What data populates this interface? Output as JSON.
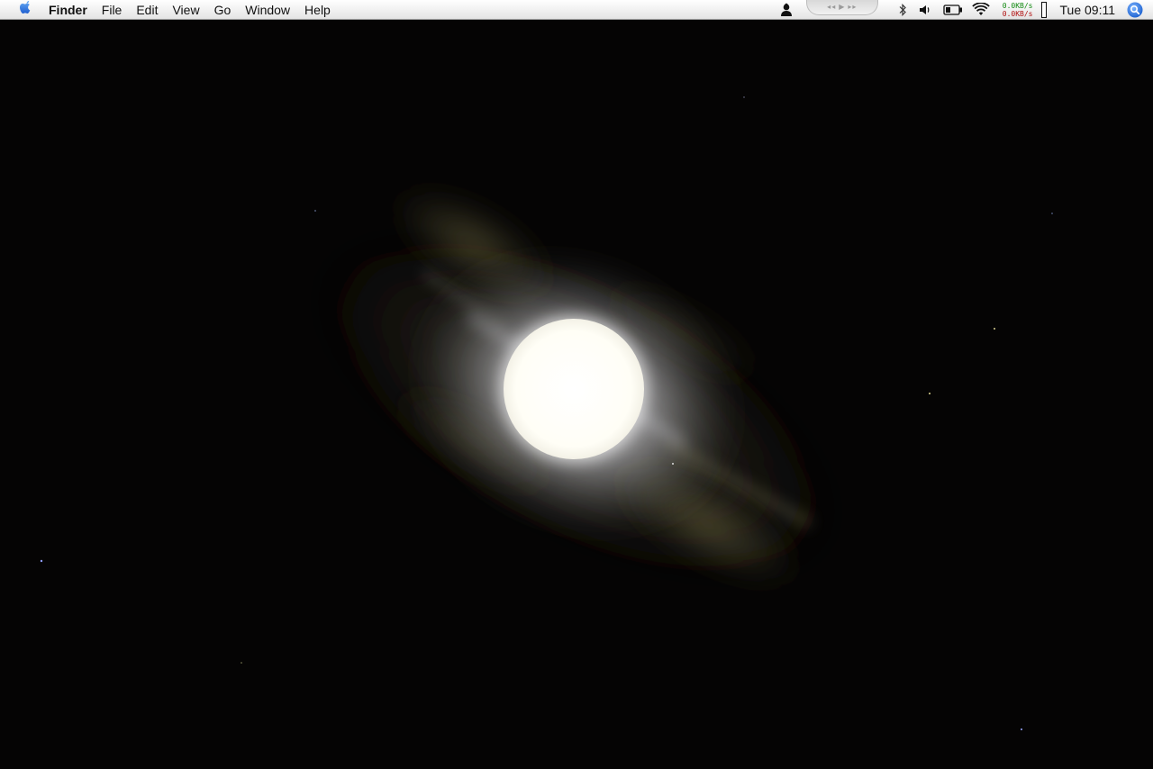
{
  "menubar": {
    "apple_icon": "apple-icon",
    "app_name": "Finder",
    "menus": [
      "File",
      "Edit",
      "View",
      "Go",
      "Window",
      "Help"
    ],
    "status_icons": [
      "user-silhouette-icon",
      "media-controls",
      "bluetooth-icon",
      "volume-icon",
      "battery-icon",
      "wifi-icon"
    ],
    "network": {
      "upload": "0.0KB/s",
      "download": "0.0KB/s"
    },
    "clock": "Tue 09:11",
    "spotlight_icon": "spotlight-search-icon"
  },
  "desktop": {
    "wallpaper": "night sky with full moon and halo"
  },
  "colors": {
    "menubar_bg": "#f0f0f0",
    "desktop_bg": "#050404",
    "moon": "#ffffff",
    "halo": "#6b6a4e",
    "spotlight": "#3a7bd5",
    "net_up": "#128a12",
    "net_down": "#b01010"
  }
}
